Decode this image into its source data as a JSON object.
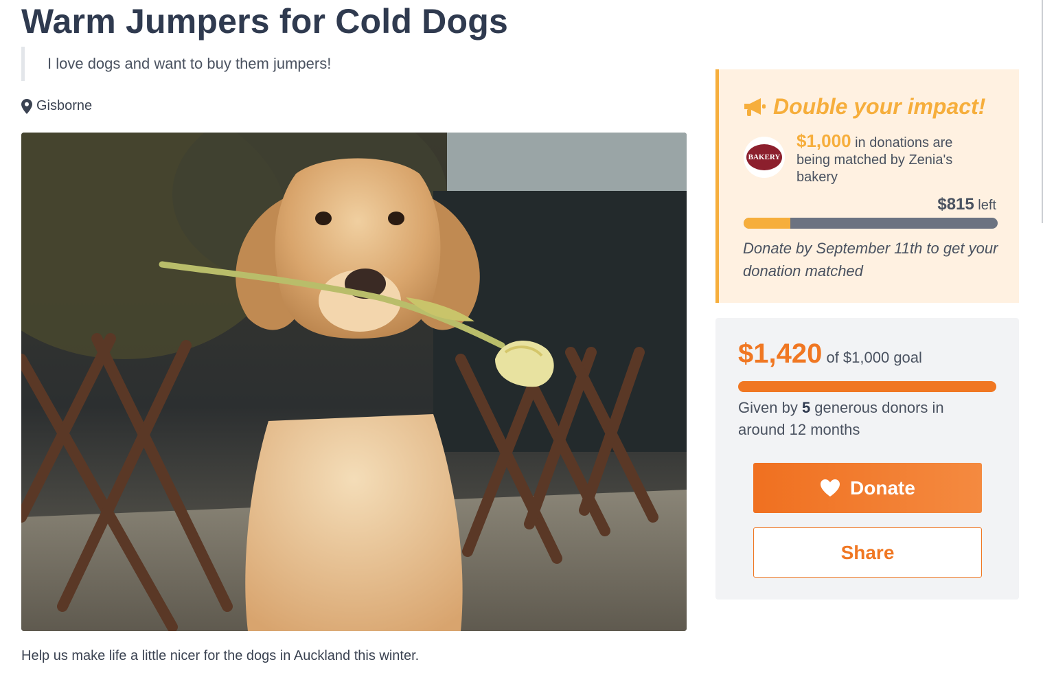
{
  "campaign": {
    "title": "Warm Jumpers for Cold Dogs",
    "tagline": "I love dogs and want to buy them jumpers!",
    "location": "Gisborne",
    "description": "Help us make life a little nicer for the dogs in Auckland this winter.",
    "hero_image": "golden retriever puppy holding a yellow tulip in front of a wooden fence"
  },
  "match": {
    "heading": "Double your impact!",
    "icon": "megaphone-icon",
    "amount": "$1,000",
    "text": " in donations are being matched by Zenia's bakery",
    "sponsor_logo_text": "BAKERY",
    "left_amount": "$815",
    "left_label": " left",
    "used_fraction": 0.185,
    "deadline": "Donate by September 11th to get your donation matched",
    "accent_color": "#f6ae3c"
  },
  "donation": {
    "raised": "$1,420",
    "goal_text": " of $1,000 goal",
    "progress_fraction": 1.0,
    "given_prefix": "Given by ",
    "donor_count": "5",
    "given_suffix": " generous donors in around 12 months",
    "donate_label": "Donate",
    "donate_icon": "heart-icon",
    "share_label": "Share",
    "accent_color": "#f07722"
  }
}
